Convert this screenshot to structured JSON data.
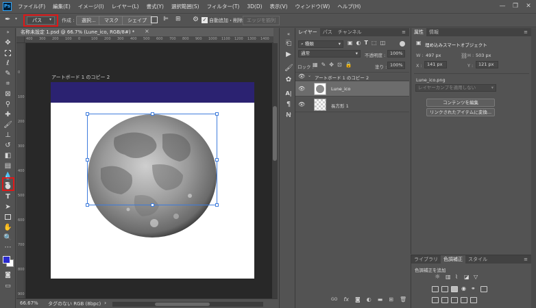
{
  "app": {
    "logo_text": "Ps",
    "menu": [
      "ファイル(F)",
      "編集(E)",
      "イメージ(I)",
      "レイヤー(L)",
      "書式(Y)",
      "選択範囲(S)",
      "フィルター(T)",
      "3D(D)",
      "表示(V)",
      "ウィンドウ(W)",
      "ヘルプ(H)"
    ],
    "window_controls": {
      "minimize": "—",
      "restore": "❐",
      "close": "✕"
    }
  },
  "options": {
    "mode_value": "パス",
    "make_label": "作成 :",
    "select_button": "選択...",
    "mask_button": "マスク",
    "shape_button": "シェイプ",
    "auto_add_delete_label": "自動追加・削除",
    "align_edges_label": "エッジを揃列"
  },
  "document": {
    "tab_title": "名称未設定 1.psd @ 66.7% (Lune_ico, RGB/8#) *",
    "tab_close": "×",
    "artboard_label": "アートボード 1 のコピー 2",
    "ruler_top_marks": [
      "400",
      "300",
      "200",
      "100",
      "0",
      "100",
      "200",
      "300",
      "400",
      "500",
      "600",
      "700",
      "800",
      "900",
      "1000",
      "1100",
      "1200",
      "1300",
      "1400"
    ],
    "ruler_left_marks": [
      "0",
      "100",
      "200",
      "300",
      "400",
      "500",
      "600",
      "700",
      "800",
      "900"
    ]
  },
  "status": {
    "zoom": "66.67%",
    "info": "タグのない RGB (8bpc)",
    "arrow": "›"
  },
  "layers": {
    "tabs": [
      "レイヤー",
      "パス",
      "チャンネル"
    ],
    "filter_kind": "種類",
    "blend_mode": "通常",
    "opacity_label": "不透明度 :",
    "opacity_value": "100%",
    "lock_label": "ロック :",
    "fill_label": "塗り :",
    "fill_value": "100%",
    "group_name": "アートボード 1 のコピー 2",
    "items": [
      {
        "name": "Lune_ico",
        "selected": true
      },
      {
        "name": "長方形 1",
        "selected": false
      }
    ],
    "footer_icons": [
      "link-icon",
      "fx-icon",
      "mask-icon",
      "adjustment-icon",
      "folder-icon",
      "new-layer-icon",
      "trash-icon"
    ],
    "footer_text": {
      "link": "GO",
      "fx": "fx"
    }
  },
  "properties": {
    "tabs": [
      "属性",
      "情報"
    ],
    "type_label": "埋め込みスマートオブジェクト",
    "w_label": "W :",
    "w_value": "497 px",
    "h_label": "H :",
    "h_value": "503 px",
    "x_label": "X :",
    "x_value": "141 px",
    "y_label": "Y :",
    "y_value": "121 px",
    "filename": "Lune_ico.png",
    "comp_placeholder": "レイヤーカンプを適用しない",
    "edit_contents": "コンテンツを編集",
    "convert_linked": "リンクされたアイテムに変換..."
  },
  "adjustments": {
    "tabs": [
      "ライブラリ",
      "色調補正",
      "スタイル"
    ],
    "add_label": "色調補正を追加"
  },
  "colors": {
    "artboard_bar": "#2b2271",
    "highlight": "#e01818",
    "selection": "#3d7bdc",
    "foreground": "#2b2bcf",
    "background": "#ffffff"
  }
}
